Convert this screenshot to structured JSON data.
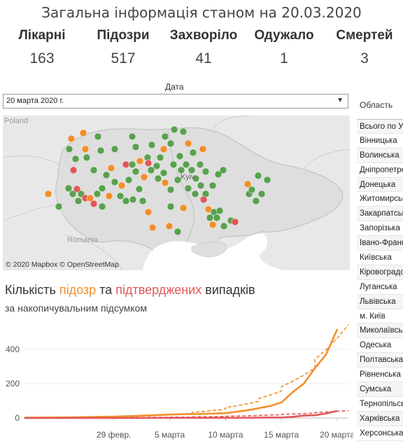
{
  "header": {
    "title": "Загальна інформація станом на 20.03.2020"
  },
  "kpis": [
    {
      "label": "Лікарні",
      "value": "163"
    },
    {
      "label": "Підозри",
      "value": "517"
    },
    {
      "label": "Захворіло",
      "value": "41"
    },
    {
      "label": "Одужало",
      "value": "1"
    },
    {
      "label": "Смертей",
      "value": "3"
    }
  ],
  "date_filter": {
    "label": "Дата",
    "value": "20 марта 2020 г."
  },
  "map": {
    "credit": "© 2020 Mapbox © OpenStreetMap",
    "labels": {
      "poland": "Poland",
      "romania": "Romania",
      "kyiv": "Kyiv"
    }
  },
  "chart": {
    "title_prefix": "Кількість ",
    "title_suspected": "підозр",
    "title_middle": " та ",
    "title_confirmed": "підтверджених",
    "title_suffix": " випадків",
    "subtitle": "за накопичувальним підсумком"
  },
  "chart_data": {
    "type": "line",
    "x": [
      "2020-02-21",
      "2020-02-25",
      "2020-02-29",
      "2020-03-02",
      "2020-03-05",
      "2020-03-08",
      "2020-03-10",
      "2020-03-12",
      "2020-03-14",
      "2020-03-15",
      "2020-03-16",
      "2020-03-17",
      "2020-03-18",
      "2020-03-19",
      "2020-03-20"
    ],
    "series": [
      {
        "name": "підозр",
        "color": "#f28e2b",
        "values": [
          2,
          4,
          8,
          12,
          20,
          24,
          28,
          45,
          70,
          90,
          150,
          200,
          290,
          370,
          517
        ]
      },
      {
        "name": "підтверджених",
        "color": "#e15759",
        "values": [
          0,
          0,
          0,
          0,
          1,
          1,
          1,
          1,
          3,
          3,
          7,
          14,
          16,
          26,
          41
        ]
      }
    ],
    "x_ticks": [
      "29 февр.",
      "5 марта",
      "10 марта",
      "15 марта",
      "20 марта"
    ],
    "y_ticks": [
      "0",
      "200",
      "400"
    ],
    "ylim": [
      0,
      530
    ],
    "trend_lines": true
  },
  "regions": {
    "header": "Область",
    "items": [
      "Всього по Україні",
      "Вінницька",
      "Волинська",
      "Дніпропетровська",
      "Донецька",
      "Житомирська",
      "Закарпатська",
      "Запорізька",
      "Івано-Франківська",
      "Київська",
      "Кіровоградська",
      "Луганська",
      "Львівська",
      "м. Київ",
      "Миколаївська",
      "Одеська",
      "Полтавська",
      "Рівненська",
      "Сумська",
      "Тернопільська",
      "Харківська",
      "Херсонська"
    ]
  }
}
